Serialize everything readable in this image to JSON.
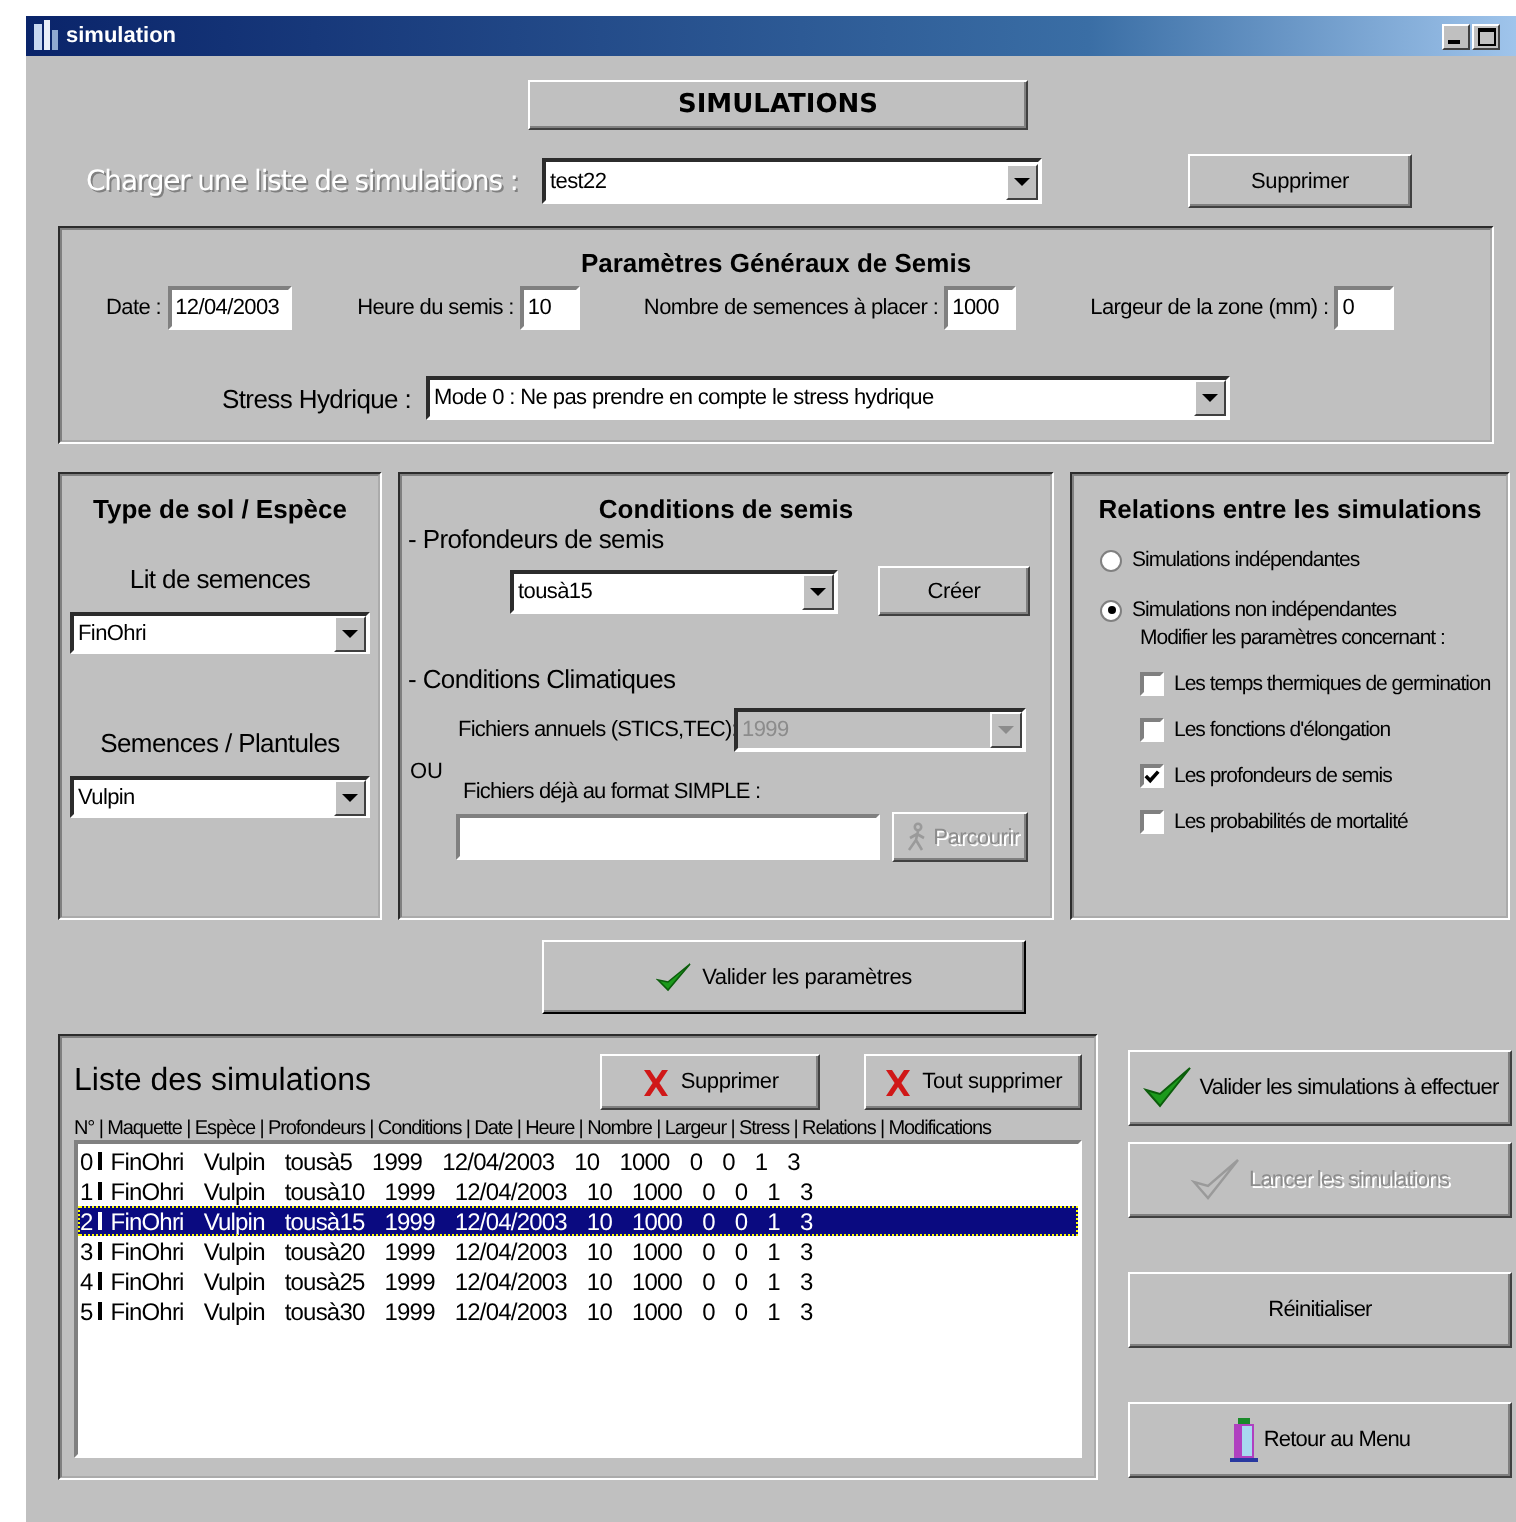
{
  "window": {
    "title": "simulation"
  },
  "header": {
    "title": "SIMULATIONS"
  },
  "load": {
    "label": "Charger une liste de simulations :",
    "value": "test22",
    "button": "Supprimer"
  },
  "general": {
    "title": "Paramètres Généraux de Semis",
    "fields": [
      {
        "label": "Date :",
        "value": "12/04/2003"
      },
      {
        "label": "Heure du semis :",
        "value": "10"
      },
      {
        "label": "Nombre de semences à placer :",
        "value": "1000"
      },
      {
        "label": "Largeur de la zone (mm) :",
        "value": "0"
      }
    ],
    "stress": {
      "label": "Stress Hydrique :",
      "value": "Mode 0 : Ne pas prendre en compte le stress hydrique"
    }
  },
  "soil": {
    "title": "Type de sol / Espèce",
    "bed": {
      "label": "Lit de semences",
      "value": "FinOhri"
    },
    "seeds": {
      "label": "Semences / Plantules",
      "value": "Vulpin"
    }
  },
  "conditions": {
    "title": "Conditions de semis",
    "depths_label": "- Profondeurs de semis",
    "depth_value": "tousà15",
    "create_button": "Créer",
    "climate_label": "- Conditions Climatiques",
    "annual_label": "Fichiers annuels (STICS,TEC):",
    "annual_value": "1999",
    "annual_disabled": true,
    "or_label": "OU",
    "simple_label": "Fichiers déjà au format SIMPLE :",
    "browse_button": "Parcourir",
    "browse_disabled": true
  },
  "relations": {
    "title": "Relations entre les simulations",
    "options": [
      {
        "label": "Simulations indépendantes",
        "selected": false
      },
      {
        "label": "Simulations non indépendantes",
        "selected": true
      }
    ],
    "modify_label": "Modifier les paramètres concernant :",
    "checks": [
      {
        "label": "Les temps thermiques de germination",
        "checked": false
      },
      {
        "label": "Les fonctions d'élongation",
        "checked": false
      },
      {
        "label": "Les profondeurs de semis",
        "checked": true
      },
      {
        "label": "Les probabilités de mortalité",
        "checked": false
      }
    ]
  },
  "validate_button": "Valider les paramètres",
  "list": {
    "title": "Liste des simulations",
    "delete_button": "Supprimer",
    "delete_all_button": "Tout supprimer",
    "header": "N° | Maquette | Espèce | Profondeurs | Conditions | Date | Heure | Nombre | Largeur | Stress | Relations | Modifications",
    "rows": [
      {
        "number": "0",
        "cells": [
          "FinOhri",
          "Vulpin",
          "tousà5",
          "1999",
          "12/04/2003",
          "10",
          "1000",
          "0",
          "0",
          "1",
          "3"
        ],
        "selected": false
      },
      {
        "number": "1",
        "cells": [
          "FinOhri",
          "Vulpin",
          "tousà10",
          "1999",
          "12/04/2003",
          "10",
          "1000",
          "0",
          "0",
          "1",
          "3"
        ],
        "selected": false
      },
      {
        "number": "2",
        "cells": [
          "FinOhri",
          "Vulpin",
          "tousà15",
          "1999",
          "12/04/2003",
          "10",
          "1000",
          "0",
          "0",
          "1",
          "3"
        ],
        "selected": true
      },
      {
        "number": "3",
        "cells": [
          "FinOhri",
          "Vulpin",
          "tousà20",
          "1999",
          "12/04/2003",
          "10",
          "1000",
          "0",
          "0",
          "1",
          "3"
        ],
        "selected": false
      },
      {
        "number": "4",
        "cells": [
          "FinOhri",
          "Vulpin",
          "tousà25",
          "1999",
          "12/04/2003",
          "10",
          "1000",
          "0",
          "0",
          "1",
          "3"
        ],
        "selected": false
      },
      {
        "number": "5",
        "cells": [
          "FinOhri",
          "Vulpin",
          "tousà30",
          "1999",
          "12/04/2003",
          "10",
          "1000",
          "0",
          "0",
          "1",
          "3"
        ],
        "selected": false
      }
    ]
  },
  "actions": [
    {
      "label": "Valider les simulations à effectuer",
      "kind": "check",
      "disabled": false
    },
    {
      "label": "Lancer les simulations",
      "kind": "check",
      "disabled": true
    },
    {
      "label": "Réinitialiser",
      "kind": "plain",
      "disabled": false
    },
    {
      "label": "Retour au Menu",
      "kind": "door",
      "disabled": false
    }
  ]
}
